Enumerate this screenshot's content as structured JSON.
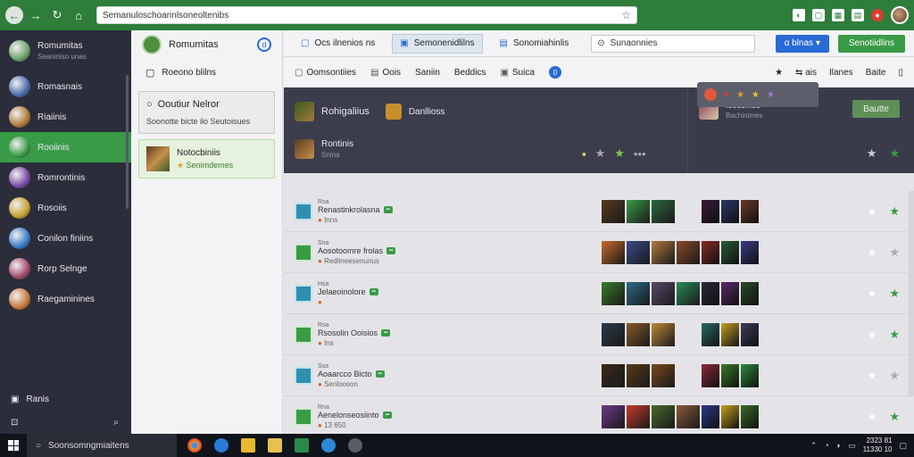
{
  "browser": {
    "url": "Semanuloschoarinlsoneoltenibs",
    "star": "☆"
  },
  "sidebar": {
    "items": [
      {
        "label": "Romumitas",
        "sub": "Seaniniso unas",
        "color": "#6aa06a"
      },
      {
        "label": "Romasnais",
        "sub": "",
        "color": "#4a6aa8"
      },
      {
        "label": "Riaiinis",
        "sub": "",
        "color": "#b07a3a"
      },
      {
        "label": "Rooiinis",
        "sub": "",
        "color": "#3a9b47"
      },
      {
        "label": "Romrontinis",
        "sub": "",
        "color": "#7a4aa8"
      },
      {
        "label": "Rosoiis",
        "sub": "",
        "color": "#c8a030"
      },
      {
        "label": "Conilon finiins",
        "sub": "",
        "color": "#3a7ac8"
      },
      {
        "label": "Rorp Selnge",
        "sub": "",
        "color": "#a04a6a"
      },
      {
        "label": "Raegaminines",
        "sub": "",
        "color": "#c8783a"
      }
    ],
    "bottom_label": "Ranis"
  },
  "mid": {
    "title": "Romumitas",
    "badge": "d",
    "row": "Roeono blilns",
    "card_title": "Ooutiur Nelror",
    "card_sub": "Soonotte bicte ilo Seutoisues",
    "card2_title": "Notocbiniis",
    "card2_sub": "Senimdemes"
  },
  "tabs": [
    {
      "label": "Ocs ilnenios ns",
      "icon": "▢"
    },
    {
      "label": "Semonenidlilns",
      "icon": "▣"
    },
    {
      "label": "Sonomiahinlis",
      "icon": "▤"
    }
  ],
  "search": {
    "value": "Sunaonnies"
  },
  "buttons": {
    "blue": "ɑ blnas ▾",
    "green": "Senotiidlins"
  },
  "toolbar": {
    "items": [
      "Oomsontiies",
      "Oois",
      "Saniin",
      "Beddics",
      "Suica"
    ],
    "badge": "0",
    "right": [
      "ais",
      "Ilanes",
      "Baite"
    ]
  },
  "hero": {
    "title": "Rohigaliius",
    "sub_label": "Danllioss",
    "row2_title": "Rontinis",
    "row2_sub": "Snina",
    "right_title": "Ioocolnos",
    "right_sub": "Bachinimes",
    "right_btn": "Bautte"
  },
  "rows": [
    {
      "id": "Rsa",
      "name": "Renastinkrolasna",
      "meta": "Inns",
      "badge": "green"
    },
    {
      "id": "Sna",
      "name": "Aosotoomre frolas",
      "meta": "Redlineesenunus",
      "badge": "grey"
    },
    {
      "id": "Hsa",
      "name": "Jelaeoinolore",
      "meta": "",
      "badge": "green"
    },
    {
      "id": "Rsa",
      "name": "Rsosolin Ooisios",
      "meta": "Ins",
      "badge": "green"
    },
    {
      "id": "Ssa",
      "name": "Aoaarcco Bicto",
      "meta": "Senlooson",
      "badge": "grey"
    },
    {
      "id": "Rna",
      "name": "Aenelonseosiinto",
      "meta": "13 650",
      "badge": "green"
    }
  ],
  "taskbar": {
    "search": "Soonsomngmiaitens",
    "time": "2323 81",
    "date": "11330 10"
  }
}
